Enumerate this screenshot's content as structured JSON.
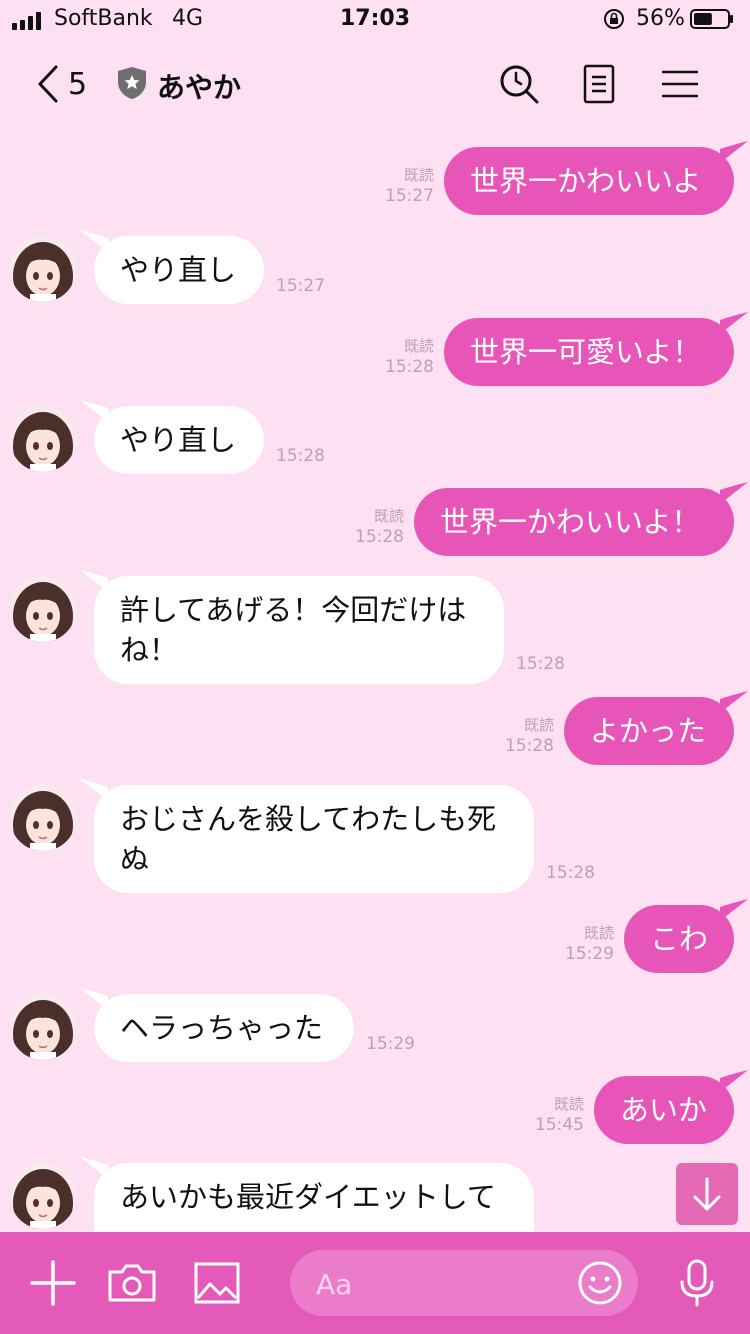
{
  "status_bar": {
    "carrier": "SoftBank",
    "network": "4G",
    "time": "17:03",
    "battery_pct": "56%",
    "battery_level": 0.56,
    "signal_bars": 4
  },
  "header": {
    "unread_count": "5",
    "contact_name": "あやか",
    "icons": [
      "back-chevron-icon",
      "shield-star-icon",
      "search-icon",
      "note-icon",
      "menu-icon"
    ]
  },
  "messages": [
    {
      "dir": "out",
      "text": "世界一かわいいよ",
      "read": "既読",
      "time": "15:27"
    },
    {
      "dir": "in",
      "text": "やり直し",
      "time": "15:27"
    },
    {
      "dir": "out",
      "text": "世界一可愛いよ！",
      "read": "既読",
      "time": "15:28"
    },
    {
      "dir": "in",
      "text": "やり直し",
      "time": "15:28"
    },
    {
      "dir": "out",
      "text": "世界一かわいいよ！",
      "read": "既読",
      "time": "15:28"
    },
    {
      "dir": "in",
      "text": "許してあげる！今回だけは\nね！",
      "time": "15:28"
    },
    {
      "dir": "out",
      "text": "よかった",
      "read": "既読",
      "time": "15:28"
    },
    {
      "dir": "in",
      "text": "おじさんを殺してわたしも死\nぬ",
      "time": "15:28"
    },
    {
      "dir": "out",
      "text": "こわ",
      "read": "既読",
      "time": "15:29"
    },
    {
      "dir": "in",
      "text": "ヘラっちゃった",
      "time": "15:29"
    },
    {
      "dir": "out",
      "text": "あいか",
      "read": "既読",
      "time": "15:45"
    },
    {
      "dir": "in",
      "text": "あいかも最近ダイエットして",
      "time": ""
    }
  ],
  "composer": {
    "placeholder": "Aa",
    "icons": [
      "plus-icon",
      "camera-icon",
      "image-icon",
      "emoji-icon",
      "microphone-icon"
    ]
  },
  "colors": {
    "background": "#fde0f1",
    "outgoing_bubble": "#e855b8",
    "incoming_bubble": "#ffffff",
    "bottom_bar": "#e35ab8"
  }
}
